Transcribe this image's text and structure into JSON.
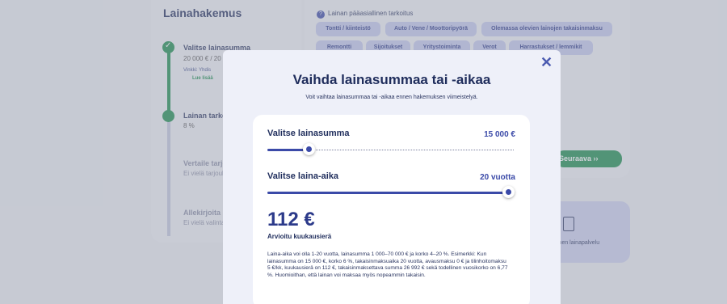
{
  "background": {
    "sidebar": {
      "title": "Lainahakemus",
      "steps": [
        {
          "title": "Valitse lainasumma",
          "sub": "20 000 € / 20"
        },
        {
          "title": "Lainan tarkoi",
          "sub": "8 %"
        },
        {
          "title": "Vertaile tarjo",
          "sub": "Ei vielä tarjouk"
        },
        {
          "title": "Allekirjoita la",
          "sub": "Ei vielä valinta"
        }
      ],
      "hint": "Vinkki: Yhdis",
      "read_more": "Lue lisää"
    },
    "purpose": {
      "label": "Lainan pääasiallinen tarkoitus",
      "chips": [
        "Tontti / kiinteistö",
        "Auto / Vene / Moottoripyörä",
        "Olemassa olevien lainojen takaisinmaksu",
        "Remontti",
        "Sijoitukset",
        "Yritystoiminta",
        "Verot",
        "Harrastukset / lemmikit"
      ]
    },
    "next_button": "Seuraava",
    "bank_panel_text": "inen lainapalvelu"
  },
  "modal": {
    "title": "Vaihda lainasummaa tai -aikaa",
    "subtitle": "Voit vaihtaa lainasummaa tai -aikaa ennen hakemuksen viimeistelyä.",
    "amount_field": {
      "label": "Valitse lainasumma",
      "value": "15 000 €",
      "level": 0.17
    },
    "term_field": {
      "label": "Valitse laina-aika",
      "value": "20 vuotta",
      "level": 1.0
    },
    "monthly": {
      "amount": "112 €",
      "label": "Arvioitu kuukausierä"
    },
    "info_text": "Laina-aika voi olla 1-20 vuotta, lainasumma 1 000–70 000 € ja korko 4–20 %. Esimerkki: Kun lainasumma on 15 000 €, korko 6 %, takaisinmaksuaika 20 vuotta, avausmaksu 0 € ja tilinhoitomaksu 5 €/kk, kuukausierä on 112 €, takaisinmaksettava summa 26 992 € sekä todellinen vuosikorko on 6,77 %. Huomioithan, että lainan voi maksaa myös nopeammin takaisin."
  },
  "colors": {
    "accent": "#3b4aa8",
    "green": "#1a8f4d",
    "chip": "#c7ccf0"
  },
  "icons": {
    "close": "close-icon",
    "check": "check-icon",
    "help": "help-icon",
    "next": "chevron-double-right-icon"
  }
}
